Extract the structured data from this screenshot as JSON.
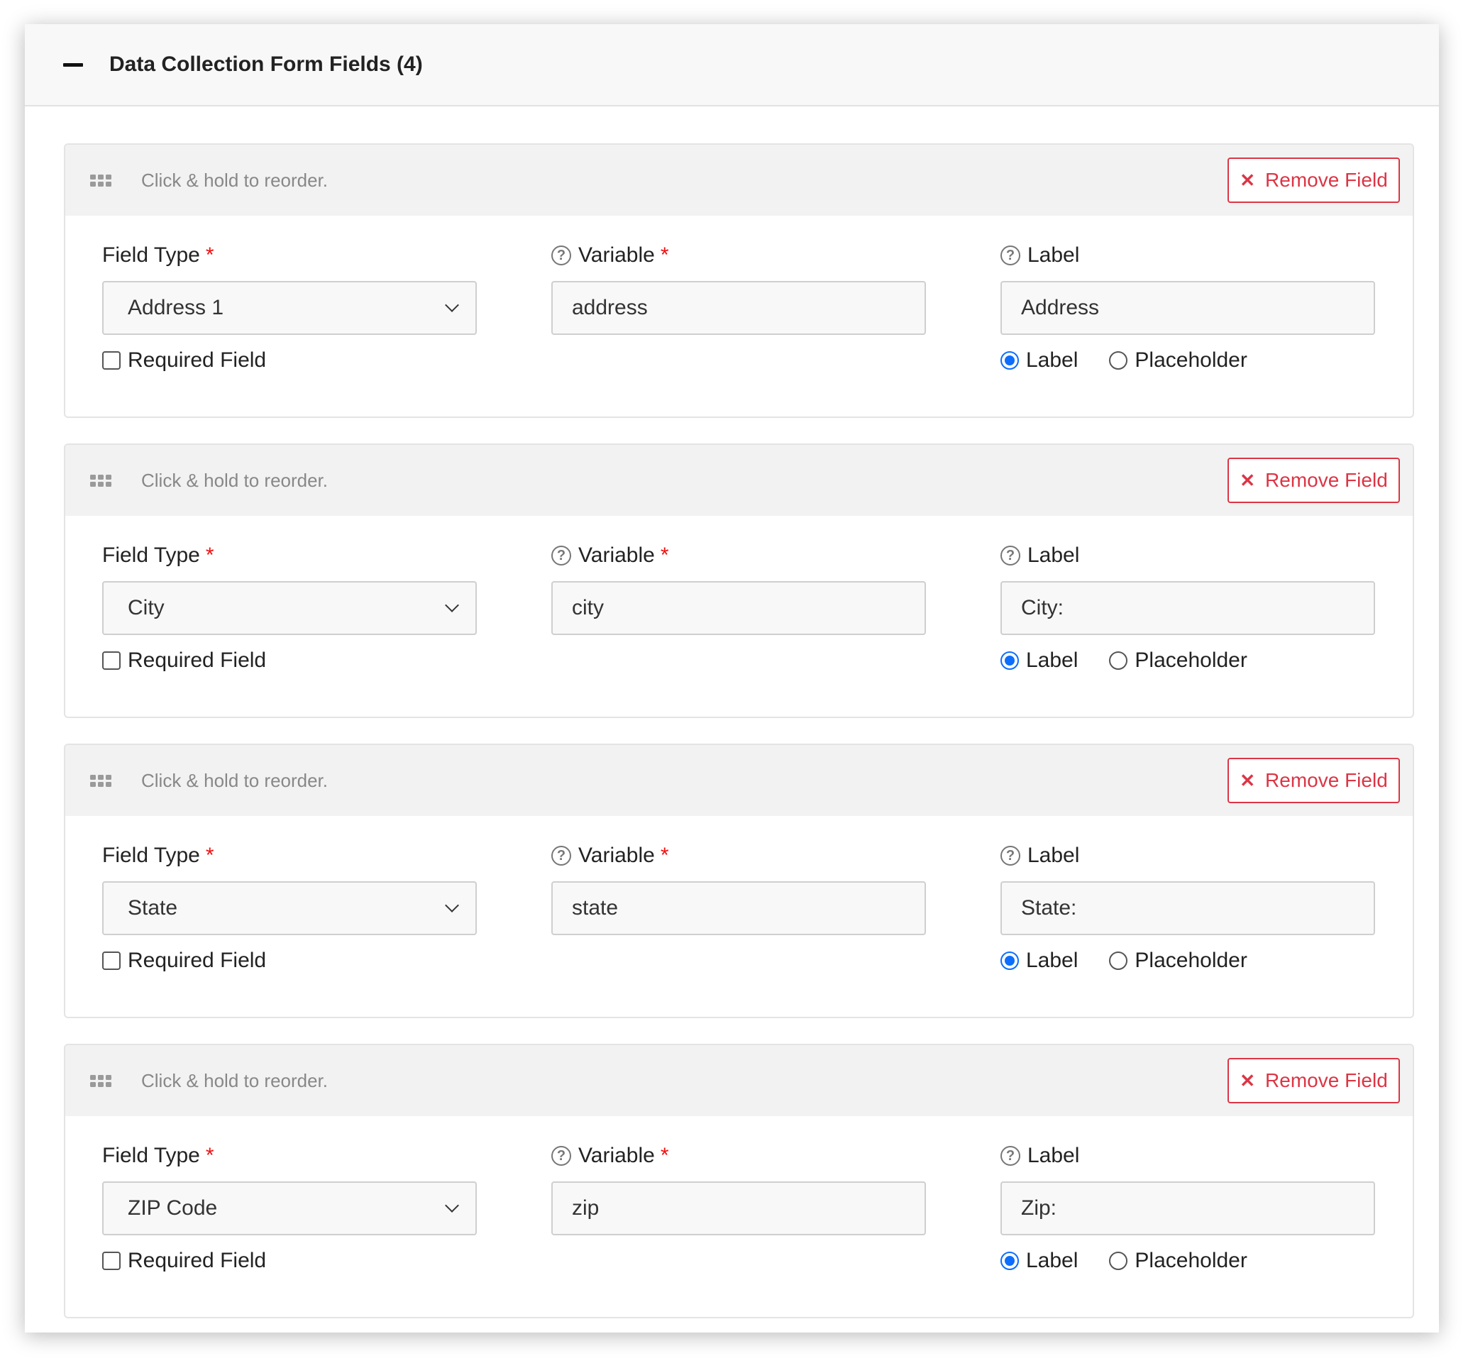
{
  "section": {
    "title": "Data Collection Form Fields (4)"
  },
  "labels": {
    "reorder_hint": "Click & hold to reorder.",
    "remove": "Remove Field",
    "field_type": "Field Type",
    "variable": "Variable",
    "label": "Label",
    "required_mark": "*",
    "required_field": "Required Field",
    "opt_label": "Label",
    "opt_placeholder": "Placeholder"
  },
  "icons": {
    "collapse": "minus-icon",
    "drag": "drag-handle-icon",
    "remove": "x-icon",
    "help": "question-circle-icon",
    "dropdown": "chevron-down-icon"
  },
  "colors": {
    "danger": "#dc3545",
    "primary": "#0d6efd",
    "required": "#ee1111"
  },
  "fields": [
    {
      "type": "Address 1",
      "variable": "address",
      "label": "Address",
      "required": false,
      "display": "Label"
    },
    {
      "type": "City",
      "variable": "city",
      "label": "City:",
      "required": false,
      "display": "Label"
    },
    {
      "type": "State",
      "variable": "state",
      "label": "State:",
      "required": false,
      "display": "Label"
    },
    {
      "type": "ZIP Code",
      "variable": "zip",
      "label": "Zip:",
      "required": false,
      "display": "Label"
    }
  ]
}
